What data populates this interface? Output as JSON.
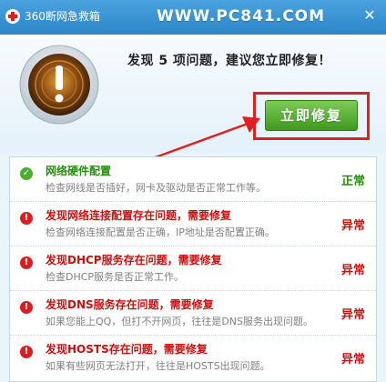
{
  "window": {
    "title": "360断网急救箱",
    "watermark": "WWW.PC841.COM",
    "close_glyph": "✕"
  },
  "header": {
    "headline": "发现 5 项问题，建议您立即修复！",
    "fix_button_label": "立即修复",
    "alarm_icon": "exclamation-alarm-icon"
  },
  "colors": {
    "ok": "#2a8a12",
    "error": "#c81010",
    "button": "#4caf2c",
    "highlight_frame": "#e02020"
  },
  "checks": [
    {
      "status": "ok",
      "icon": "check-icon",
      "glyph": "✓",
      "title": "网络硬件配置",
      "desc": "检查网线是否插好，网卡及驱动是否正常工作等。",
      "result": "正常"
    },
    {
      "status": "error",
      "icon": "exclamation-icon",
      "glyph": "!",
      "title": "发现网络连接配置存在问题，需要修复",
      "desc": "检查网络连接配置是否正确，IP地址是否配置正确。",
      "result": "异常"
    },
    {
      "status": "error",
      "icon": "exclamation-icon",
      "glyph": "!",
      "title": "发现DHCP服务存在问题，需要修复",
      "desc": "检查DHCP服务是否正常工作。",
      "result": "异常"
    },
    {
      "status": "error",
      "icon": "exclamation-icon",
      "glyph": "!",
      "title": "发现DNS服务存在问题，需要修复",
      "desc": "如果您能上QQ，但打不开网页，往往是DNS服务出现问题。",
      "result": "异常"
    },
    {
      "status": "error",
      "icon": "exclamation-icon",
      "glyph": "!",
      "title": "发现HOSTS存在问题，需要修复",
      "desc": "如果有些网页无法打开，往往是HOSTS出现问题。",
      "result": "异常"
    }
  ]
}
